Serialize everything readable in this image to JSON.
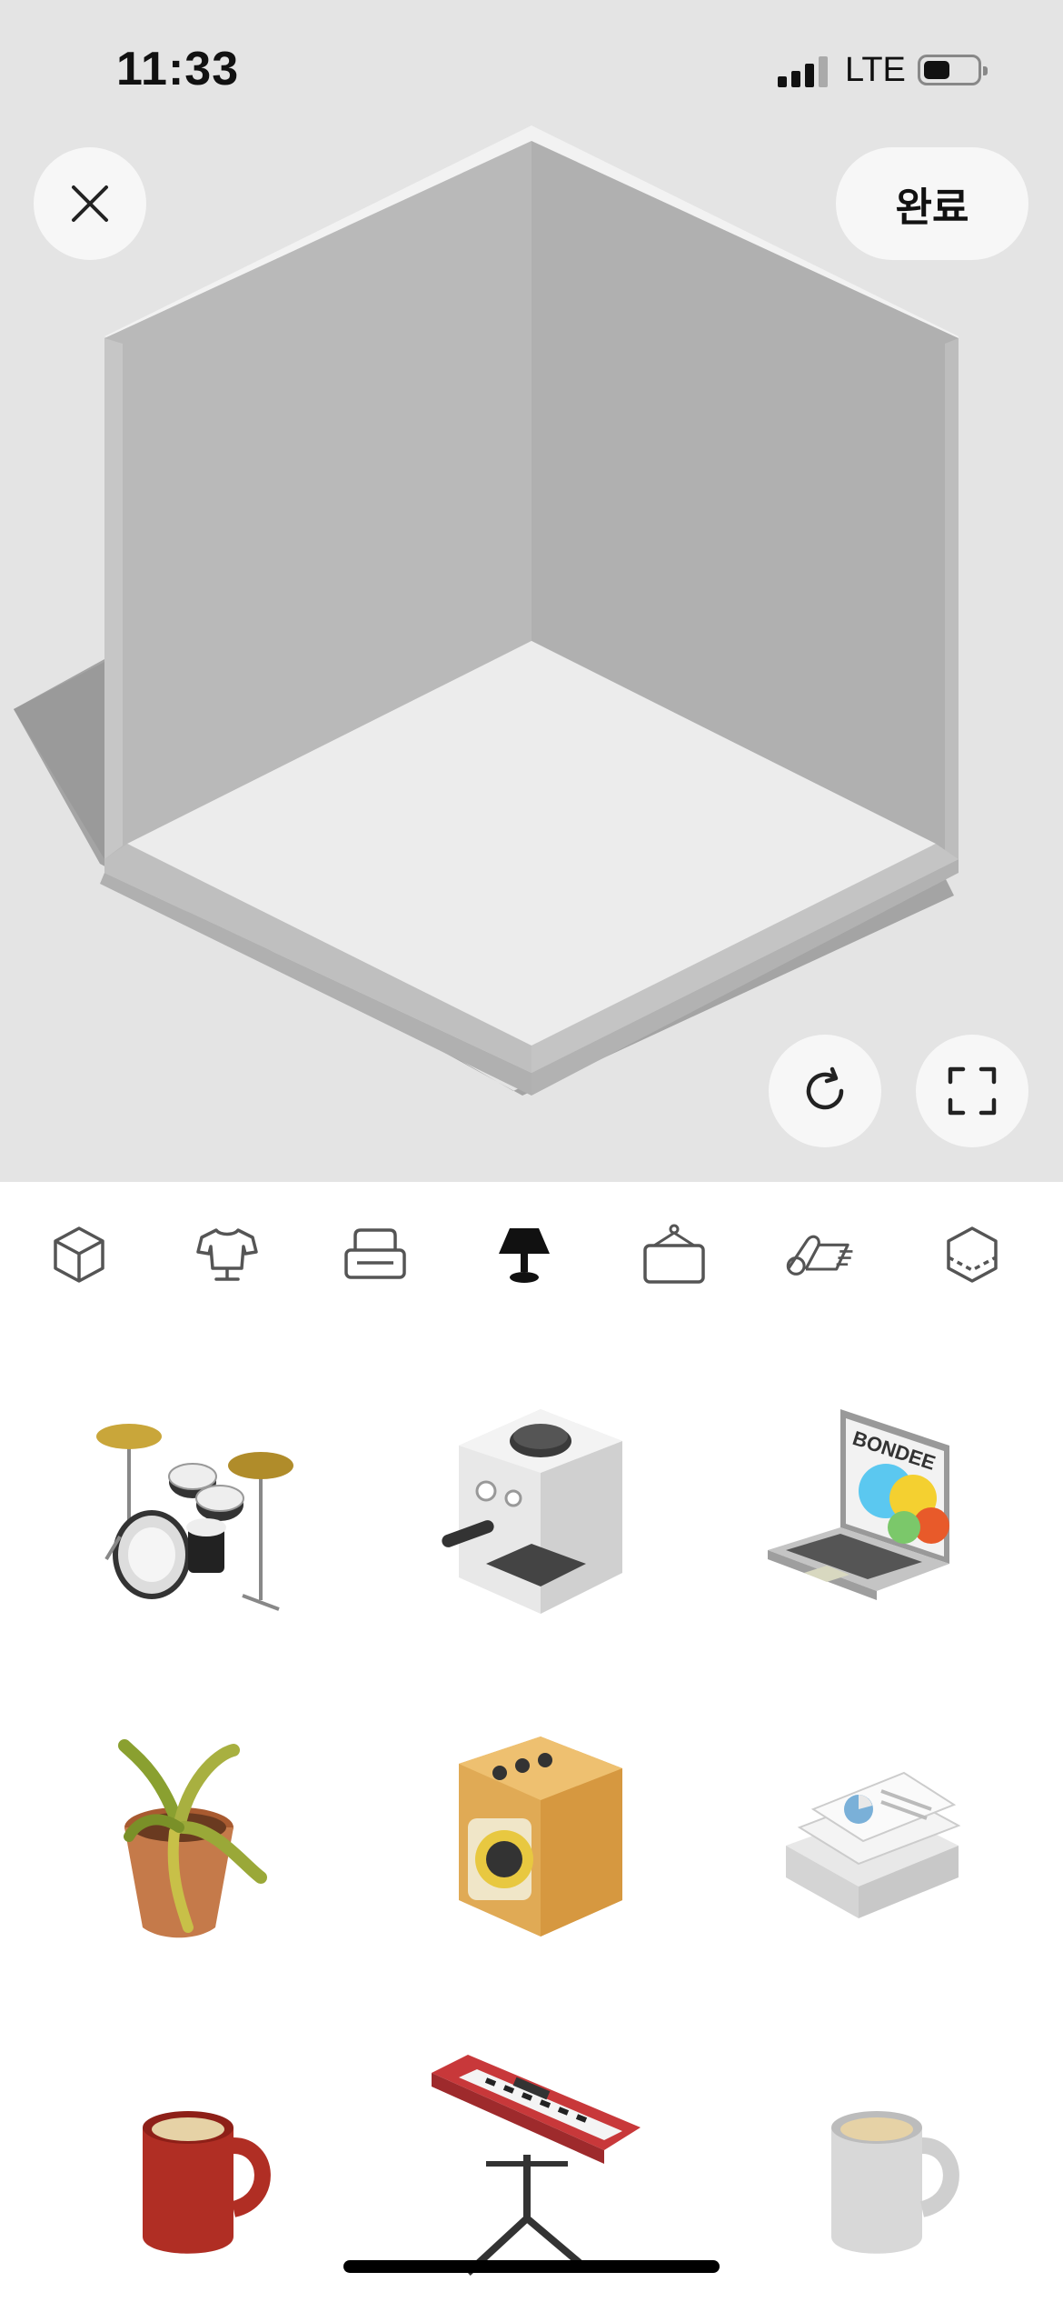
{
  "status_bar": {
    "time": "11:33",
    "network": "LTE"
  },
  "header": {
    "done_label": "완료"
  },
  "categories": [
    {
      "name": "room-cube-icon",
      "selected": false
    },
    {
      "name": "tshirt-icon",
      "selected": false
    },
    {
      "name": "sofa-icon",
      "selected": false
    },
    {
      "name": "lamp-icon",
      "selected": true
    },
    {
      "name": "wall-frame-icon",
      "selected": false
    },
    {
      "name": "rug-roll-icon",
      "selected": false
    },
    {
      "name": "floor-cube-icon",
      "selected": false
    }
  ],
  "items": [
    {
      "name": "drum-kit",
      "icon": "drum-kit-icon"
    },
    {
      "name": "espresso-machine",
      "icon": "espresso-machine-icon"
    },
    {
      "name": "laptop",
      "icon": "laptop-icon",
      "screen_text": "BONDEE"
    },
    {
      "name": "potted-plant",
      "icon": "potted-plant-icon"
    },
    {
      "name": "washing-machine",
      "icon": "washing-machine-icon"
    },
    {
      "name": "paper-stack",
      "icon": "paper-stack-icon"
    },
    {
      "name": "red-mug",
      "icon": "mug-icon"
    },
    {
      "name": "keyboard-stand",
      "icon": "keyboard-icon"
    },
    {
      "name": "white-mug",
      "icon": "mug-icon"
    }
  ],
  "colors": {
    "accent": "#111111",
    "background_top": "#e4e4e4",
    "button_bg": "#f7f7f7"
  }
}
